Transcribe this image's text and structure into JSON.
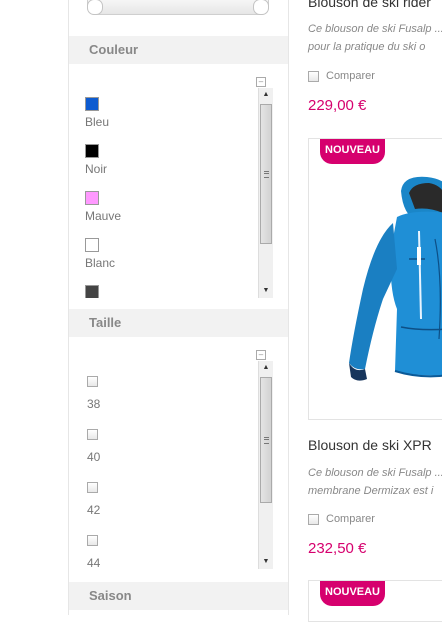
{
  "sidebar": {
    "color_section": {
      "title": "Couleur",
      "items": [
        {
          "label": "Bleu",
          "color": "#0d5bd0"
        },
        {
          "label": "Noir",
          "color": "#000000"
        },
        {
          "label": "Mauve",
          "color": "#ff99ff"
        },
        {
          "label": "Blanc",
          "color": "#ffffff"
        },
        {
          "label": "",
          "color": "#444444"
        }
      ]
    },
    "size_section": {
      "title": "Taille",
      "items": [
        {
          "label": "38"
        },
        {
          "label": "40"
        },
        {
          "label": "42"
        },
        {
          "label": "44"
        }
      ]
    },
    "season_section": {
      "title": "Saison"
    },
    "collapse_symbol": "–"
  },
  "products": [
    {
      "title": "Blouson de ski rider",
      "desc_lines": [
        "Ce blouson de ski Fusalp ...",
        "pour la pratique du ski o"
      ],
      "compare_label": "Comparer",
      "price": "229,00 €"
    },
    {
      "badge": "NOUVEAU",
      "title": "Blouson de ski XPR",
      "desc_lines": [
        "Ce blouson de ski Fusalp ...",
        "membrane Dermizax est i"
      ],
      "compare_label": "Comparer",
      "price": "232,50 €"
    },
    {
      "badge": "NOUVEAU"
    }
  ]
}
